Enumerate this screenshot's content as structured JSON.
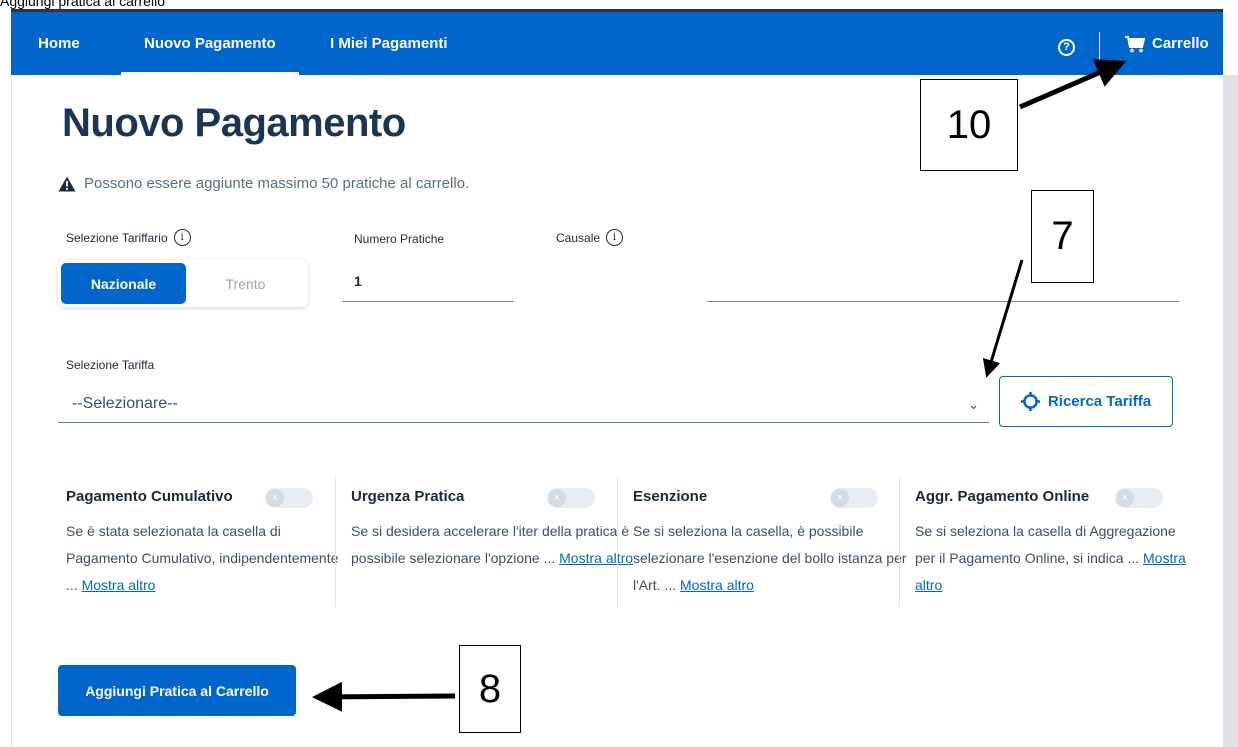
{
  "caption": "Aggiungi pratica al carrello",
  "nav": {
    "home": "Home",
    "nuovo": "Nuovo Pagamento",
    "miei": "I Miei Pagamenti",
    "help_icon": "question-circle-icon",
    "help_glyph": "?",
    "cart": "Carrello",
    "cart_icon": "cart-icon"
  },
  "page": {
    "title": "Nuovo Pagamento",
    "warning": "Possono essere aggiunte massimo 50 pratiche al carrello.",
    "warning_icon": "warning-triangle-icon"
  },
  "form": {
    "tariffario_label": "Selezione Tariffario",
    "info_glyph": "i",
    "tariffario_options": [
      "Nazionale",
      "Trento"
    ],
    "tariffario_selected": "Nazionale",
    "numero_label": "Numero Pratiche",
    "numero_value": "1",
    "causale_label": "Causale",
    "causale_value": "",
    "tariffa_label": "Selezione Tariffa",
    "tariffa_value": "--Selezionare--",
    "ricerca_button": "Ricerca Tariffa",
    "ricerca_icon": "crosshair-icon"
  },
  "options": [
    {
      "title": "Pagamento Cumulativo",
      "text": "Se è stata selezionata la casella di Pagamento Cumulativo, indipendentemente ...",
      "more": "Mostra altro",
      "enabled": false
    },
    {
      "title": "Urgenza Pratica",
      "text": "Se si desidera accelerare l'iter della pratica è possibile selezionare l'opzione ...",
      "more": "Mostra altro",
      "enabled": false
    },
    {
      "title": "Esenzione",
      "text": "Se si seleziona la casella, è possibile selezionare l'esenzione del bollo istanza per l'Art. ...",
      "more": "Mostra altro",
      "enabled": false
    },
    {
      "title": "Aggr. Pagamento Online",
      "text": "Se si seleziona la casella di Aggregazione per il Pagamento Online, si indica ...",
      "more": "Mostra altro",
      "enabled": false
    }
  ],
  "toggle_glyph": "×",
  "add_button": "Aggiungi Pratica al Carrello",
  "callouts": {
    "cart": "10",
    "select": "7",
    "add": "8"
  },
  "colors": {
    "primary": "#0066cc",
    "title": "#1c3553",
    "text": "#3d4f62"
  }
}
